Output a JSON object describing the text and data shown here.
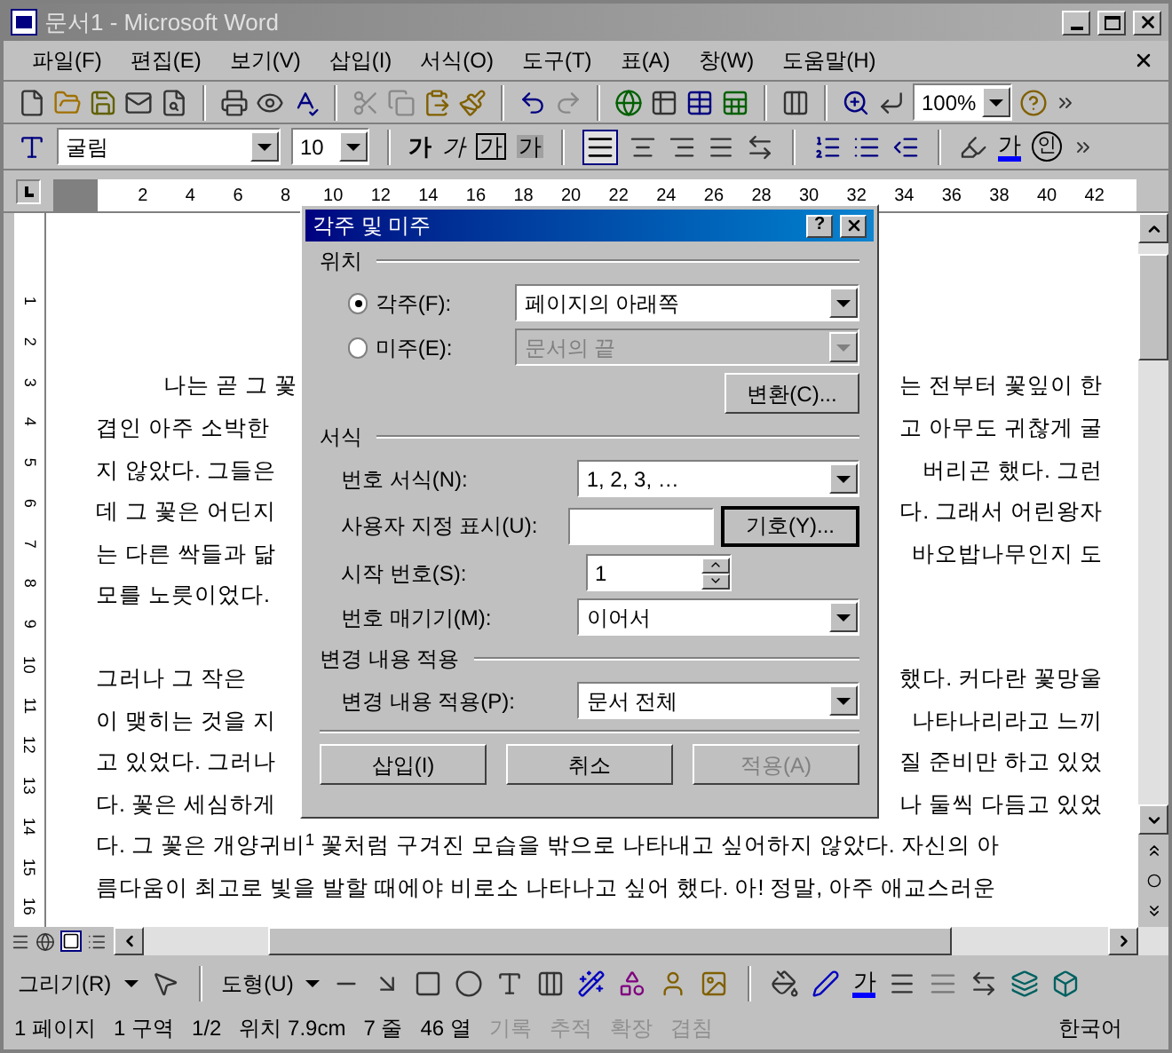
{
  "window": {
    "title": "문서1 - Microsoft Word"
  },
  "menu": [
    "파일(F)",
    "편집(E)",
    "보기(V)",
    "삽입(I)",
    "서식(O)",
    "도구(T)",
    "표(A)",
    "창(W)",
    "도움말(H)"
  ],
  "standard_toolbar": {
    "zoom": "100%"
  },
  "formatting_toolbar": {
    "font": "굴림",
    "size": "10",
    "style_buttons": [
      {
        "kind": "bold",
        "label": "가"
      },
      {
        "kind": "italic",
        "label": "가"
      },
      {
        "kind": "boxed",
        "label": "가"
      },
      {
        "kind": "shaded",
        "label": "가"
      }
    ],
    "font_color_label": "가",
    "enclosed_label": "인"
  },
  "ruler": {
    "ticks": [
      "2",
      "4",
      "6",
      "8",
      "10",
      "12",
      "14",
      "16",
      "18",
      "20",
      "22",
      "24",
      "26",
      "28",
      "30",
      "32",
      "34",
      "36",
      "38",
      "40",
      "42"
    ],
    "vertical_ticks": [
      "1",
      "2",
      "3",
      "4",
      "5",
      "6",
      "7",
      "8",
      "9",
      "10",
      "11",
      "12",
      "13",
      "14",
      "15",
      "16"
    ]
  },
  "document": {
    "paragraphs": [
      {
        "first_line_indent": true,
        "lines": [
          {
            "left": "나는 곧 그 꽃",
            "right": "는 전부터 꽃잎이 한"
          },
          {
            "left": "겹인 아주 소박한",
            "right": "고 아무도 귀찮게 굴"
          },
          {
            "left": "지 않았다. 그들은",
            "right": "버리곤 했다. 그런"
          },
          {
            "left": "데 그 꽃은 어딘지",
            "right": "다. 그래서 어린왕자"
          },
          {
            "left": "는 다른 싹들과 닮",
            "right": "바오밥나무인지 도"
          },
          {
            "left": "모를 노릇이었다."
          }
        ]
      },
      {
        "first_line_indent": false,
        "lines": [
          {
            "left": "그러나 그 작은",
            "right": "했다. 커다란 꽃망울"
          },
          {
            "left": "이 맺히는 것을 지",
            "right": "나타나리라고 느끼"
          },
          {
            "left": "고 있었다. 그러나",
            "right": "질 준비만 하고 있었"
          },
          {
            "left": "다. 꽃은 세심하게",
            "right": "나 둘씩 다듬고 있었"
          },
          {
            "left": "다. 그 꽃은 개양귀비$^{1}$ 꽃처럼 구겨진 모습을 밖으로 나타내고 싶어하지 않았다. 자신의 아"
          },
          {
            "left": "름다움이 최고로 빛을 발할 때에야 비로소 나타나고 싶어 했다. 아! 정말, 아주 애교스러운"
          }
        ]
      }
    ]
  },
  "dialog": {
    "title": "각주 및 미주",
    "help": "?",
    "position": {
      "heading": "위치",
      "options": [
        {
          "label": "각주(F):",
          "selected": true,
          "value": "페이지의 아래쪽",
          "disabled": false
        },
        {
          "label": "미주(E):",
          "selected": false,
          "value": "문서의 끝",
          "disabled": true
        }
      ],
      "convert_button": "변환(C)..."
    },
    "format": {
      "heading": "서식",
      "number_format_label": "번호 서식(N):",
      "number_format": "1, 2, 3, …",
      "custom_mark_label": "사용자 지정 표시(U):",
      "symbol_button": "기호(Y)...",
      "start_label": "시작 번호(S):",
      "start_value": "1",
      "numbering_label": "번호 매기기(M):",
      "numbering": "이어서"
    },
    "apply": {
      "heading": "변경 내용 적용",
      "label": "변경 내용 적용(P):",
      "value": "문서 전체"
    },
    "buttons": [
      {
        "label": "삽입(I)",
        "disabled": false
      },
      {
        "label": "취소",
        "disabled": false
      },
      {
        "label": "적용(A)",
        "disabled": true
      }
    ]
  },
  "drawing_toolbar": {
    "draw_menu": "그리기(R)",
    "shapes_menu": "도형(U)",
    "font_color_label": "가"
  },
  "status_bar": [
    {
      "text": "1 페이지",
      "disabled": false
    },
    {
      "text": "1 구역",
      "disabled": false
    },
    {
      "text": "1/2",
      "disabled": false
    },
    {
      "text": "위치 7.9cm",
      "disabled": false
    },
    {
      "text": "7 줄",
      "disabled": false
    },
    {
      "text": "46 열",
      "disabled": false
    },
    {
      "text": "기록",
      "disabled": true
    },
    {
      "text": "추적",
      "disabled": true
    },
    {
      "text": "확장",
      "disabled": true
    },
    {
      "text": "겹침",
      "disabled": true
    },
    {
      "text": "한국어",
      "disabled": false
    }
  ]
}
